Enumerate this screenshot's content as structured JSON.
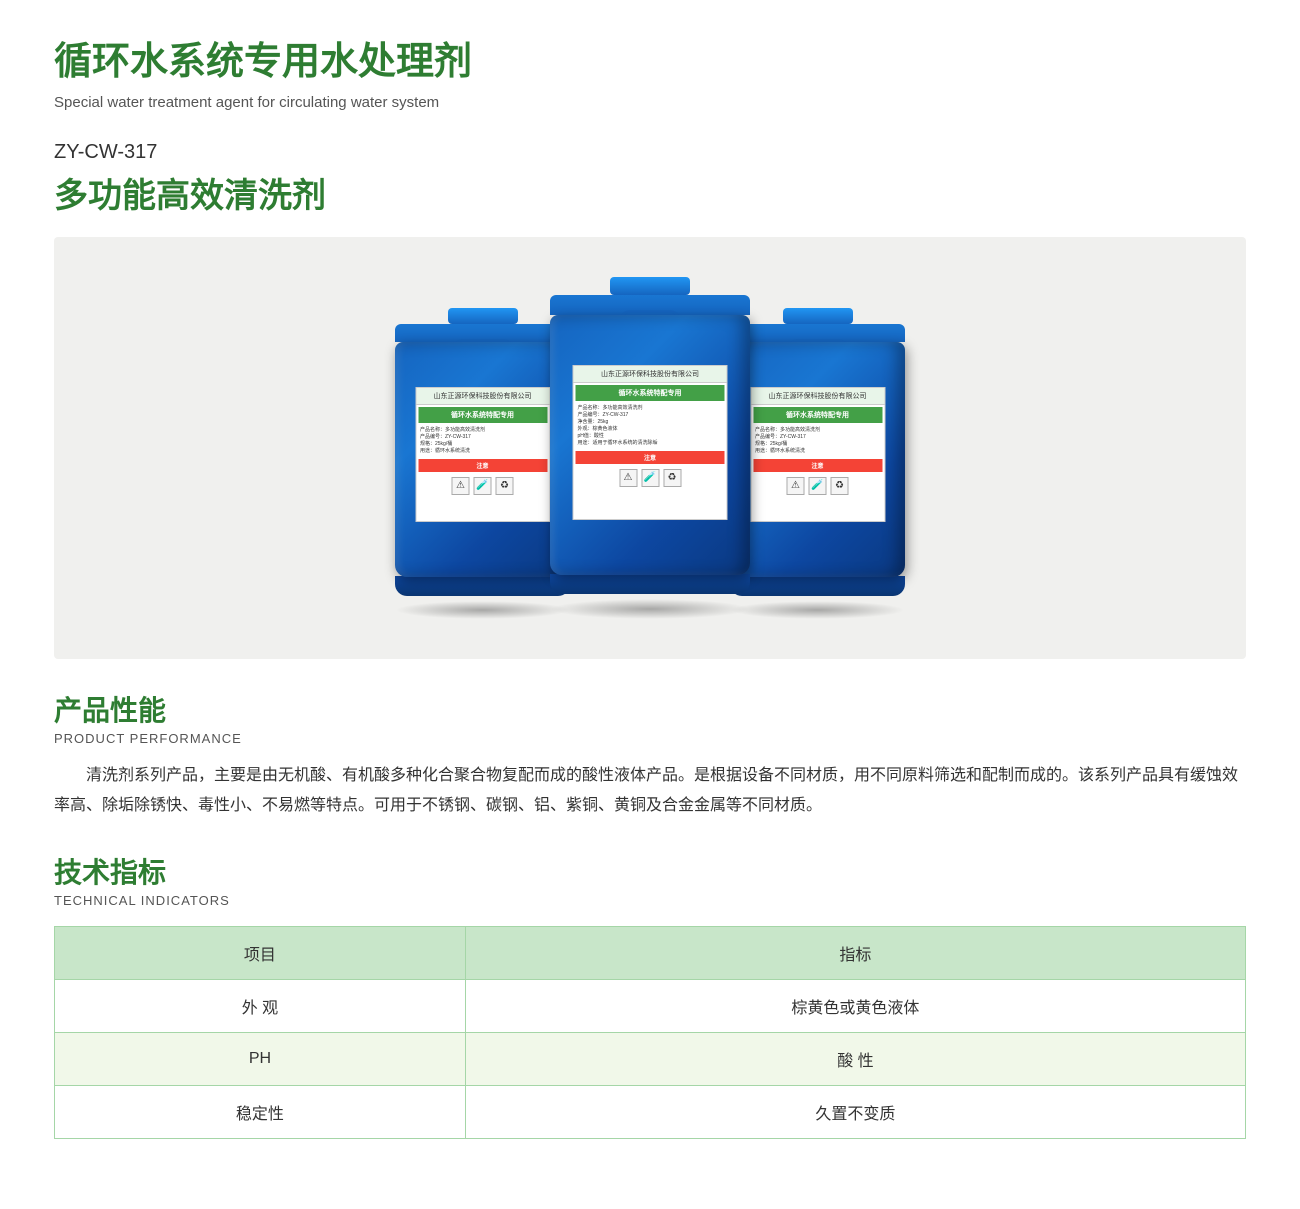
{
  "page": {
    "main_title": "循环水系统专用水处理剂",
    "subtitle": "Special water treatment agent for circulating water system",
    "product_code": "ZY-CW-317",
    "product_name": "多功能高效清洗剂",
    "performance_section": {
      "title_cn": "产品性能",
      "title_en": "PRODUCT PERFORMANCE",
      "text": "清洗剂系列产品，主要是由无机酸、有机酸多种化合聚合物复配而成的酸性液体产品。是根据设备不同材质，用不同原料筛选和配制而成的。该系列产品具有缓蚀效率高、除垢除锈快、毒性小、不易燃等特点。可用于不锈钢、碳钢、铝、紫铜、黄铜及合金金属等不同材质。"
    },
    "indicators_section": {
      "title_cn": "技术指标",
      "title_en": "TECHNICAL INDICATORS",
      "table": {
        "headers": [
          "项目",
          "指标"
        ],
        "rows": [
          [
            "外 观",
            "棕黄色或黄色液体"
          ],
          [
            "PH",
            "酸 性"
          ],
          [
            "稳定性",
            "久置不变质"
          ]
        ]
      }
    }
  }
}
